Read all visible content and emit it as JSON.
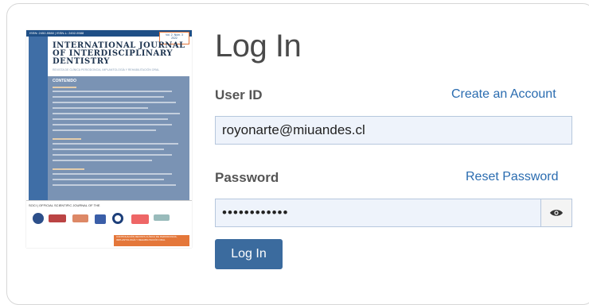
{
  "cover": {
    "issn": "ISSN: 2452-5588 | ISSN-L: 2452-5588",
    "volume": "Vol. 2. Núm. 3",
    "volume_detail": "2022",
    "title": "INTERNATIONAL JOURNAL OF INTERDISCIPLINARY DENTISTRY",
    "subtitle": "REVISTA DE CLÍNICA PERIODONCIA, IMPLANTOLOGÍA Y REHABILITACIÓN ORAL",
    "contents_heading": "CONTENIDO",
    "footer": "SOCI | OFFICIAL SCIENTIFIC JOURNAL OF THE",
    "orange_text": "CONTINUACIÓN REVISTA CLÍNICA DE PERIODONCIA, IMPLANTOLOGÍA Y REHABILITACIÓN ORAL"
  },
  "login": {
    "heading": "Log In",
    "user_label": "User ID",
    "create_account": "Create an Account",
    "user_value": "royonarte@miuandes.cl",
    "password_label": "Password",
    "reset_password": "Reset Password",
    "password_value": "••••••••••••",
    "submit_label": "Log In"
  },
  "colors": {
    "accent": "#3b6b9e",
    "link": "#2a6cb0",
    "input_bg": "#eef3fb"
  },
  "icons": {
    "password_toggle": "eye-icon"
  }
}
